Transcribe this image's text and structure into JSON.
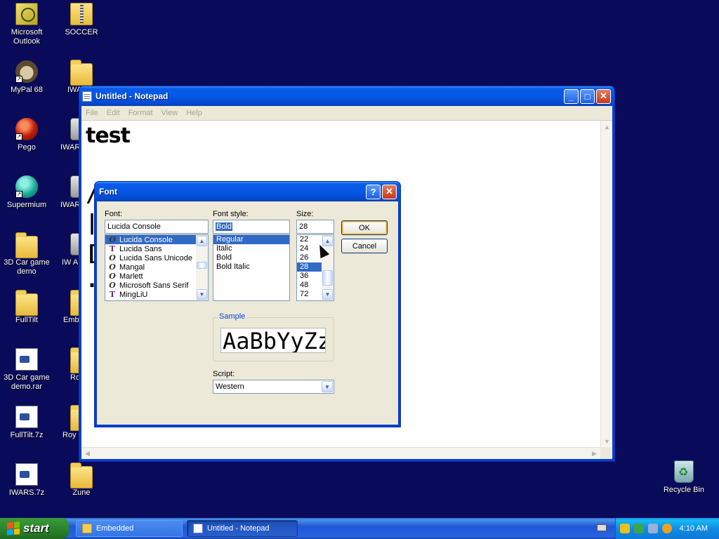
{
  "desktop": {
    "icons": [
      {
        "label": "Microsoft Outlook",
        "icon": "outlook-icon"
      },
      {
        "label": "SOCCER",
        "icon": "zip-folder-icon"
      },
      {
        "label": "MyPal 68",
        "icon": "raccoon-icon"
      },
      {
        "label": "IWA",
        "icon": "folder-icon"
      },
      {
        "label": "Pego",
        "icon": "pego-icon"
      },
      {
        "label": "IWAR",
        "icon": "app-icon"
      },
      {
        "label": "Supermium",
        "icon": "supermium-icon"
      },
      {
        "label": "IWAR Outp",
        "icon": "app-icon"
      },
      {
        "label": "3D Car game demo",
        "icon": "folder-icon"
      },
      {
        "label": "IW Auto",
        "icon": "app-icon"
      },
      {
        "label": "FullTilt",
        "icon": "folder-icon"
      },
      {
        "label": "Emb",
        "icon": "folder-icon"
      },
      {
        "label": "3D Car game demo.rar",
        "icon": "archive-icon"
      },
      {
        "label": "Ro",
        "icon": "folder-icon"
      },
      {
        "label": "FullTilt.7z",
        "icon": "archive-icon"
      },
      {
        "label": "Roy",
        "icon": "folder-icon"
      },
      {
        "label": "IWARS.7z",
        "icon": "archive-icon"
      },
      {
        "label": "Zune",
        "icon": "folder-icon"
      }
    ],
    "recycle_bin": "Recycle Bin"
  },
  "notepad": {
    "title": "Untitled - Notepad",
    "menu": [
      "File",
      "Edit",
      "Format",
      "View",
      "Help"
    ],
    "text": "test",
    "obscured_chars": [
      "/",
      "|-",
      "[",
      "."
    ]
  },
  "font_dialog": {
    "title": "Font",
    "help_button": "?",
    "close_button": "✕",
    "font_label": "Font:",
    "font_value": "Lucida Console",
    "fonts": [
      {
        "name": "Lucida Console",
        "type": "O",
        "selected": true
      },
      {
        "name": "Lucida Sans",
        "type": "T",
        "selected": false
      },
      {
        "name": "Lucida Sans Unicode",
        "type": "O",
        "selected": false
      },
      {
        "name": "Mangal",
        "type": "O",
        "selected": false
      },
      {
        "name": "Marlett",
        "type": "O",
        "selected": false
      },
      {
        "name": "Microsoft Sans Serif",
        "type": "O",
        "selected": false
      },
      {
        "name": "MingLiU",
        "type": "T",
        "selected": false
      }
    ],
    "style_label": "Font style:",
    "style_value": "Bold",
    "styles": [
      {
        "name": "Regular",
        "selected": true
      },
      {
        "name": "Italic",
        "selected": false
      },
      {
        "name": "Bold",
        "selected": false
      },
      {
        "name": "Bold Italic",
        "selected": false
      }
    ],
    "size_label": "Size:",
    "size_value": "28",
    "sizes": [
      {
        "name": "22",
        "selected": false
      },
      {
        "name": "24",
        "selected": false
      },
      {
        "name": "26",
        "selected": false
      },
      {
        "name": "28",
        "selected": true
      },
      {
        "name": "36",
        "selected": false
      },
      {
        "name": "48",
        "selected": false
      },
      {
        "name": "72",
        "selected": false
      }
    ],
    "ok": "OK",
    "cancel": "Cancel",
    "sample_label": "Sample",
    "sample_text": "AaBbYyZz",
    "script_label": "Script:",
    "script_value": "Western"
  },
  "taskbar": {
    "start": "start",
    "tasks": [
      {
        "label": "Embedded",
        "active": false
      },
      {
        "label": "Untitled - Notepad",
        "active": true
      }
    ],
    "clock": "4:10 AM"
  },
  "colors": {
    "desktop_bg": "#0a0a5a",
    "title_blue": "#0558e6",
    "selection": "#316ac5"
  }
}
